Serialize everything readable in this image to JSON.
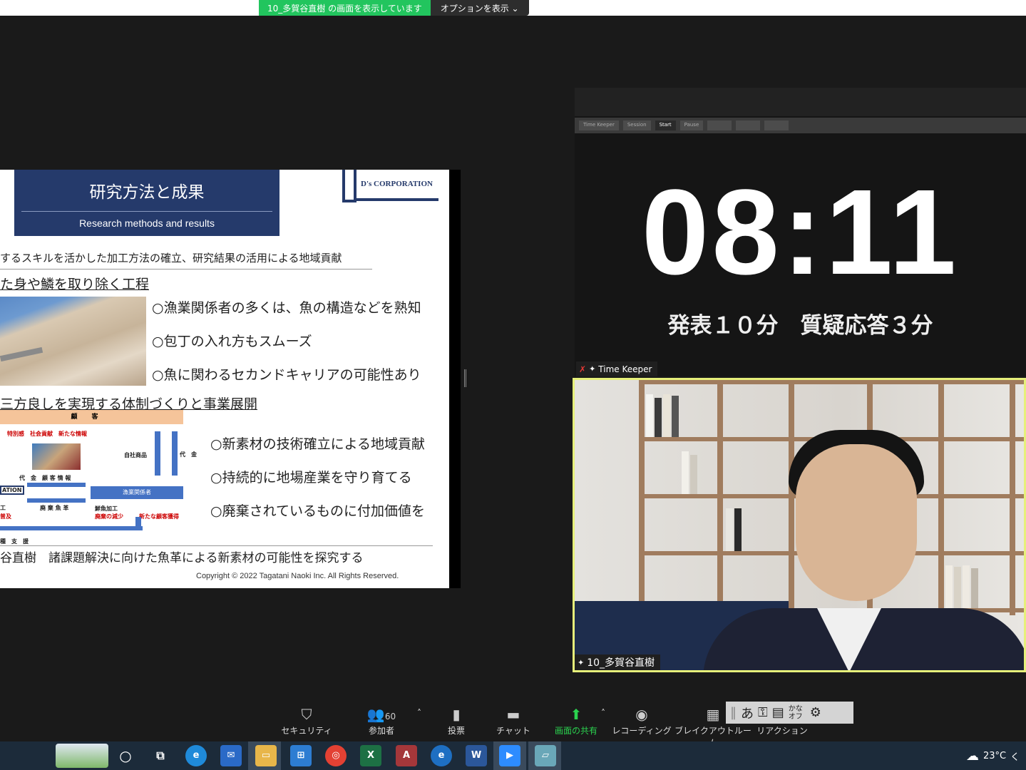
{
  "share_banner": {
    "sharing_text": "10_多賀谷直樹 の画面を表示しています",
    "options_label": "オプションを表示 ⌄"
  },
  "slide": {
    "title": "研究方法と成果",
    "subtitle": "Research methods and results",
    "logo_text": "D's CORPORATION",
    "intro_line": "するスキルを活かした加工方法の確立、研究結果の活用による地域貢献",
    "section1_heading": "た身や鱗を取り除く工程",
    "bullets1": [
      "○漁業関係者の多くは、魚の構造などを熟知",
      "○包丁の入れ方もスムーズ",
      "○魚に関わるセカンドキャリアの可能性あり"
    ],
    "section2_heading": "三方良しを実現する体制づくりと事業展開",
    "bullets2": [
      "○新素材の技術確立による地域貢献",
      "○持続的に地場産業を守り育てる",
      "○廃棄されているものに付加価値を"
    ],
    "diagram": {
      "header": "顧客",
      "red_labels": "特別感　社会貢献　新たな情報",
      "own_product": "自社商品",
      "payment": "代　金",
      "payment_customer": "代　金　顧 客 情 報",
      "fishery_box": "漁業関係者",
      "waste_skin": "廃 棄 魚 革",
      "fresh_fish": "鮮魚加工",
      "waste_reduce": "廃棄の減少",
      "new_customers": "新たな顧客獲得",
      "left_partial1": "ATION",
      "left_partial2": "工",
      "left_partial3": "普及",
      "support": "種　支　援"
    },
    "footer_line": "谷直樹　諸課題解決に向けた魚革による新素材の可能性を探究する",
    "copyright": "Copyright © 2022  Tagatani Naoki Inc. All Rights Reserved."
  },
  "timer": {
    "toolbar_buttons": [
      "Time Keeper",
      "Session",
      "Start",
      "Pause",
      "",
      "",
      ""
    ],
    "time": "08:11",
    "subtitle": "発表１０分　質疑応答３分",
    "participant_name": "Time Keeper"
  },
  "camera": {
    "participant_name": "10_多賀谷直樹"
  },
  "toolbar": {
    "security": "セキュリティ",
    "participants": "参加者",
    "participants_count": "60",
    "polls": "投票",
    "chat": "チャット",
    "share_screen": "画面の共有",
    "record": "レコーディング",
    "breakout": "ブレイクアウトルーム",
    "reactions": "リアクション"
  },
  "ime": {
    "hiragana": "あ",
    "kana_off": "かなオフ"
  },
  "taskbar": {
    "temperature": "23°C",
    "weather_partial": "く"
  }
}
